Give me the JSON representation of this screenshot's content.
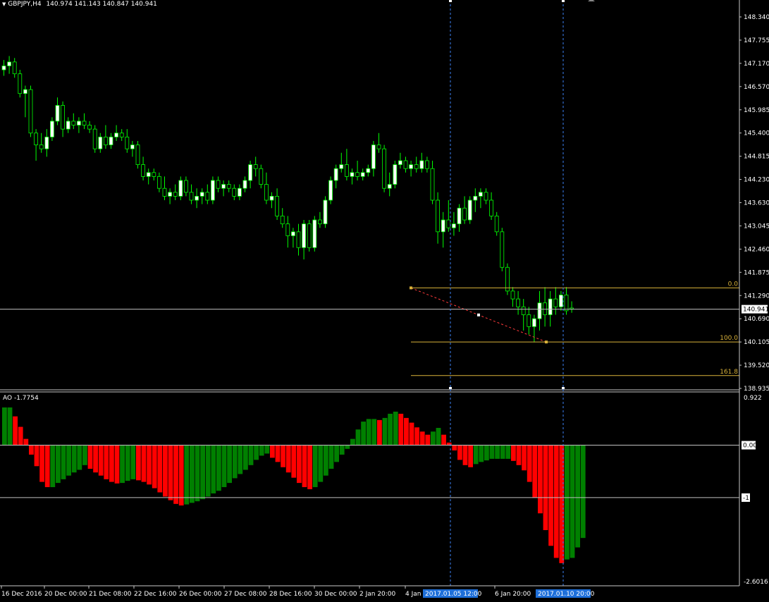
{
  "header": {
    "symbol_label": "GBPJPY,H4",
    "ohlc_text": "140.974 141.143 140.847 140.941",
    "dropdown_glyph": "▼"
  },
  "price_axis": {
    "ticks": [
      "148.340",
      "147.755",
      "147.170",
      "146.570",
      "145.985",
      "145.400",
      "144.815",
      "144.230",
      "143.630",
      "143.045",
      "142.460",
      "141.875",
      "141.290",
      "140.690",
      "140.105",
      "139.520",
      "138.935"
    ],
    "current_price": "140.941"
  },
  "fibo": {
    "levels": [
      {
        "label": "0.0",
        "price": 141.48
      },
      {
        "label": "100.0",
        "price": 140.11
      },
      {
        "label": "161.8",
        "price": 139.26
      }
    ],
    "color": "#d9b23a"
  },
  "indicator": {
    "label": "AO -1.7754",
    "axis": {
      "top_label": "0.922",
      "zero_label": "0.00",
      "minus_one_label": "-1",
      "bottom_label": "-2.6016"
    }
  },
  "time_axis": {
    "labels": [
      "16 Dec 2016",
      "20 Dec 00:00",
      "21 Dec 08:00",
      "22 Dec 16:00",
      "26 Dec 00:00",
      "27 Dec 08:00",
      "28 Dec 16:00",
      "30 Dec 00:00",
      "2 Jan 20:00",
      "4 Jan",
      "6 Jan 20:00"
    ],
    "highlights": [
      "2017.01.05 12:00",
      "2017.01.10 20:00"
    ]
  },
  "colors": {
    "background": "#000000",
    "bull_candle": "#ffffff",
    "bear_candle": "#000000",
    "wick": "#00ff00",
    "ao_up": "#008000",
    "ao_down": "#ff0000",
    "grid_line": "#c0c0c0",
    "vline": "#3b82f6",
    "highlight_bg": "#1e6fd9"
  },
  "chart_data": [
    {
      "type": "candlestick",
      "title": "GBPJPY,H4",
      "ylim": [
        138.935,
        148.34
      ],
      "ohlc": [
        [
          147.0,
          147.25,
          146.85,
          147.1
        ],
        [
          147.1,
          147.35,
          146.9,
          147.2
        ],
        [
          147.2,
          147.3,
          146.8,
          146.9
        ],
        [
          146.9,
          147.0,
          146.3,
          146.4
        ],
        [
          146.4,
          146.6,
          145.8,
          146.5
        ],
        [
          146.5,
          146.6,
          145.3,
          145.4
        ],
        [
          145.4,
          145.5,
          144.7,
          145.1
        ],
        [
          145.1,
          145.4,
          144.9,
          145.0
        ],
        [
          145.0,
          145.5,
          144.8,
          145.3
        ],
        [
          145.3,
          145.8,
          145.2,
          145.7
        ],
        [
          145.7,
          146.3,
          145.6,
          146.1
        ],
        [
          146.1,
          146.2,
          145.3,
          145.5
        ],
        [
          145.5,
          145.8,
          145.4,
          145.7
        ],
        [
          145.7,
          145.9,
          145.5,
          145.6
        ],
        [
          145.6,
          145.8,
          145.4,
          145.7
        ],
        [
          145.7,
          145.9,
          145.5,
          145.6
        ],
        [
          145.6,
          145.7,
          145.4,
          145.5
        ],
        [
          145.5,
          145.6,
          144.9,
          145.0
        ],
        [
          145.0,
          145.4,
          144.9,
          145.3
        ],
        [
          145.3,
          145.6,
          145.0,
          145.1
        ],
        [
          145.1,
          145.4,
          145.0,
          145.3
        ],
        [
          145.3,
          145.6,
          145.2,
          145.4
        ],
        [
          145.4,
          145.5,
          145.2,
          145.3
        ],
        [
          145.3,
          145.5,
          144.9,
          145.0
        ],
        [
          145.0,
          145.2,
          144.8,
          145.1
        ],
        [
          145.1,
          145.2,
          144.5,
          144.6
        ],
        [
          144.6,
          144.8,
          144.2,
          144.3
        ],
        [
          144.3,
          144.5,
          144.1,
          144.4
        ],
        [
          144.4,
          144.5,
          144.2,
          144.3
        ],
        [
          144.3,
          144.4,
          143.9,
          144.0
        ],
        [
          144.0,
          144.3,
          143.7,
          143.8
        ],
        [
          143.8,
          144.0,
          143.6,
          143.9
        ],
        [
          143.9,
          144.1,
          143.7,
          143.8
        ],
        [
          143.8,
          144.3,
          143.7,
          144.2
        ],
        [
          144.2,
          144.3,
          143.8,
          143.9
        ],
        [
          143.9,
          144.1,
          143.6,
          143.7
        ],
        [
          143.7,
          144.0,
          143.5,
          143.8
        ],
        [
          143.8,
          144.0,
          143.6,
          143.9
        ],
        [
          143.9,
          144.1,
          143.6,
          143.7
        ],
        [
          143.7,
          144.3,
          143.6,
          144.2
        ],
        [
          144.2,
          144.3,
          143.9,
          144.0
        ],
        [
          144.0,
          144.2,
          143.8,
          144.1
        ],
        [
          144.1,
          144.2,
          143.9,
          144.0
        ],
        [
          144.0,
          144.1,
          143.7,
          143.8
        ],
        [
          143.8,
          144.1,
          143.7,
          144.0
        ],
        [
          144.0,
          144.3,
          143.9,
          144.2
        ],
        [
          144.2,
          144.7,
          144.0,
          144.6
        ],
        [
          144.6,
          144.8,
          144.3,
          144.5
        ],
        [
          144.5,
          144.6,
          144.0,
          144.1
        ],
        [
          144.1,
          144.4,
          143.6,
          143.7
        ],
        [
          143.7,
          143.9,
          143.5,
          143.8
        ],
        [
          143.8,
          144.0,
          143.2,
          143.3
        ],
        [
          143.3,
          143.5,
          143.0,
          143.1
        ],
        [
          143.1,
          143.3,
          142.5,
          142.8
        ],
        [
          142.8,
          143.0,
          142.5,
          142.9
        ],
        [
          142.9,
          143.1,
          142.3,
          142.5
        ],
        [
          142.5,
          143.2,
          142.2,
          143.1
        ],
        [
          143.1,
          143.2,
          142.4,
          142.5
        ],
        [
          142.5,
          143.3,
          142.4,
          143.2
        ],
        [
          143.2,
          143.4,
          143.0,
          143.1
        ],
        [
          143.1,
          143.8,
          143.0,
          143.7
        ],
        [
          143.7,
          144.3,
          143.6,
          144.2
        ],
        [
          144.2,
          144.6,
          144.0,
          144.5
        ],
        [
          144.5,
          144.9,
          144.4,
          144.6
        ],
        [
          144.6,
          145.0,
          144.2,
          144.3
        ],
        [
          144.3,
          144.5,
          144.1,
          144.4
        ],
        [
          144.4,
          144.7,
          144.2,
          144.3
        ],
        [
          144.3,
          144.5,
          144.2,
          144.4
        ],
        [
          144.4,
          144.6,
          144.3,
          144.5
        ],
        [
          144.5,
          145.2,
          144.3,
          145.1
        ],
        [
          145.1,
          145.4,
          144.9,
          145.0
        ],
        [
          145.0,
          145.1,
          143.9,
          144.0
        ],
        [
          144.0,
          144.4,
          143.8,
          144.1
        ],
        [
          144.1,
          144.7,
          144.0,
          144.6
        ],
        [
          144.6,
          144.9,
          144.5,
          144.7
        ],
        [
          144.7,
          144.8,
          144.4,
          144.5
        ],
        [
          144.5,
          144.7,
          144.3,
          144.6
        ],
        [
          144.6,
          144.8,
          144.4,
          144.5
        ],
        [
          144.5,
          144.9,
          144.4,
          144.7
        ],
        [
          144.7,
          144.8,
          144.4,
          144.5
        ],
        [
          144.5,
          144.7,
          143.6,
          143.7
        ],
        [
          143.7,
          143.9,
          142.6,
          142.9
        ],
        [
          142.9,
          143.4,
          142.5,
          143.2
        ],
        [
          143.2,
          143.7,
          142.9,
          143.0
        ],
        [
          143.0,
          143.4,
          142.8,
          143.1
        ],
        [
          143.1,
          143.6,
          142.9,
          143.5
        ],
        [
          143.5,
          143.8,
          143.1,
          143.2
        ],
        [
          143.2,
          143.8,
          143.1,
          143.7
        ],
        [
          143.7,
          144.0,
          143.4,
          143.8
        ],
        [
          143.8,
          144.0,
          143.5,
          143.9
        ],
        [
          143.9,
          144.0,
          143.6,
          143.7
        ],
        [
          143.7,
          143.9,
          143.2,
          143.3
        ],
        [
          143.3,
          143.4,
          142.8,
          142.9
        ],
        [
          142.9,
          143.0,
          141.9,
          142.0
        ],
        [
          142.0,
          142.1,
          141.3,
          141.4
        ],
        [
          141.4,
          141.5,
          141.0,
          141.2
        ],
        [
          141.2,
          141.4,
          140.8,
          141.0
        ],
        [
          141.0,
          141.2,
          140.4,
          140.8
        ],
        [
          140.8,
          141.0,
          140.3,
          140.5
        ],
        [
          140.5,
          140.8,
          140.1,
          140.7
        ],
        [
          140.7,
          141.4,
          140.4,
          141.1
        ],
        [
          141.1,
          141.5,
          140.5,
          140.8
        ],
        [
          140.8,
          141.4,
          140.5,
          141.2
        ],
        [
          141.2,
          141.5,
          140.8,
          141.0
        ],
        [
          141.0,
          141.4,
          140.9,
          141.3
        ],
        [
          141.3,
          141.5,
          140.8,
          140.9
        ],
        [
          140.97,
          141.14,
          140.85,
          140.94
        ]
      ]
    },
    {
      "type": "bar",
      "title": "AO -1.7754",
      "ylim": [
        -2.6016,
        0.922
      ],
      "values": [
        0.72,
        0.72,
        0.55,
        0.35,
        0.12,
        -0.18,
        -0.4,
        -0.7,
        -0.8,
        -0.8,
        -0.72,
        -0.65,
        -0.58,
        -0.52,
        -0.47,
        -0.38,
        -0.45,
        -0.52,
        -0.58,
        -0.65,
        -0.7,
        -0.73,
        -0.72,
        -0.68,
        -0.65,
        -0.67,
        -0.7,
        -0.75,
        -0.82,
        -0.9,
        -0.98,
        -1.05,
        -1.12,
        -1.15,
        -1.13,
        -1.1,
        -1.07,
        -1.03,
        -0.98,
        -0.92,
        -0.87,
        -0.8,
        -0.72,
        -0.63,
        -0.55,
        -0.47,
        -0.38,
        -0.28,
        -0.2,
        -0.16,
        -0.24,
        -0.32,
        -0.42,
        -0.52,
        -0.62,
        -0.72,
        -0.8,
        -0.84,
        -0.8,
        -0.7,
        -0.58,
        -0.45,
        -0.32,
        -0.18,
        -0.07,
        0.12,
        0.3,
        0.45,
        0.5,
        0.5,
        0.48,
        0.52,
        0.6,
        0.64,
        0.6,
        0.52,
        0.43,
        0.34,
        0.26,
        0.2,
        0.26,
        0.33,
        0.2,
        0.05,
        -0.1,
        -0.28,
        -0.38,
        -0.42,
        -0.36,
        -0.32,
        -0.29,
        -0.26,
        -0.26,
        -0.26,
        -0.26,
        -0.3,
        -0.38,
        -0.48,
        -0.7,
        -1.0,
        -1.3,
        -1.62,
        -1.92,
        -2.15,
        -2.25,
        -2.18,
        -2.15,
        -1.95,
        -1.77
      ]
    }
  ]
}
